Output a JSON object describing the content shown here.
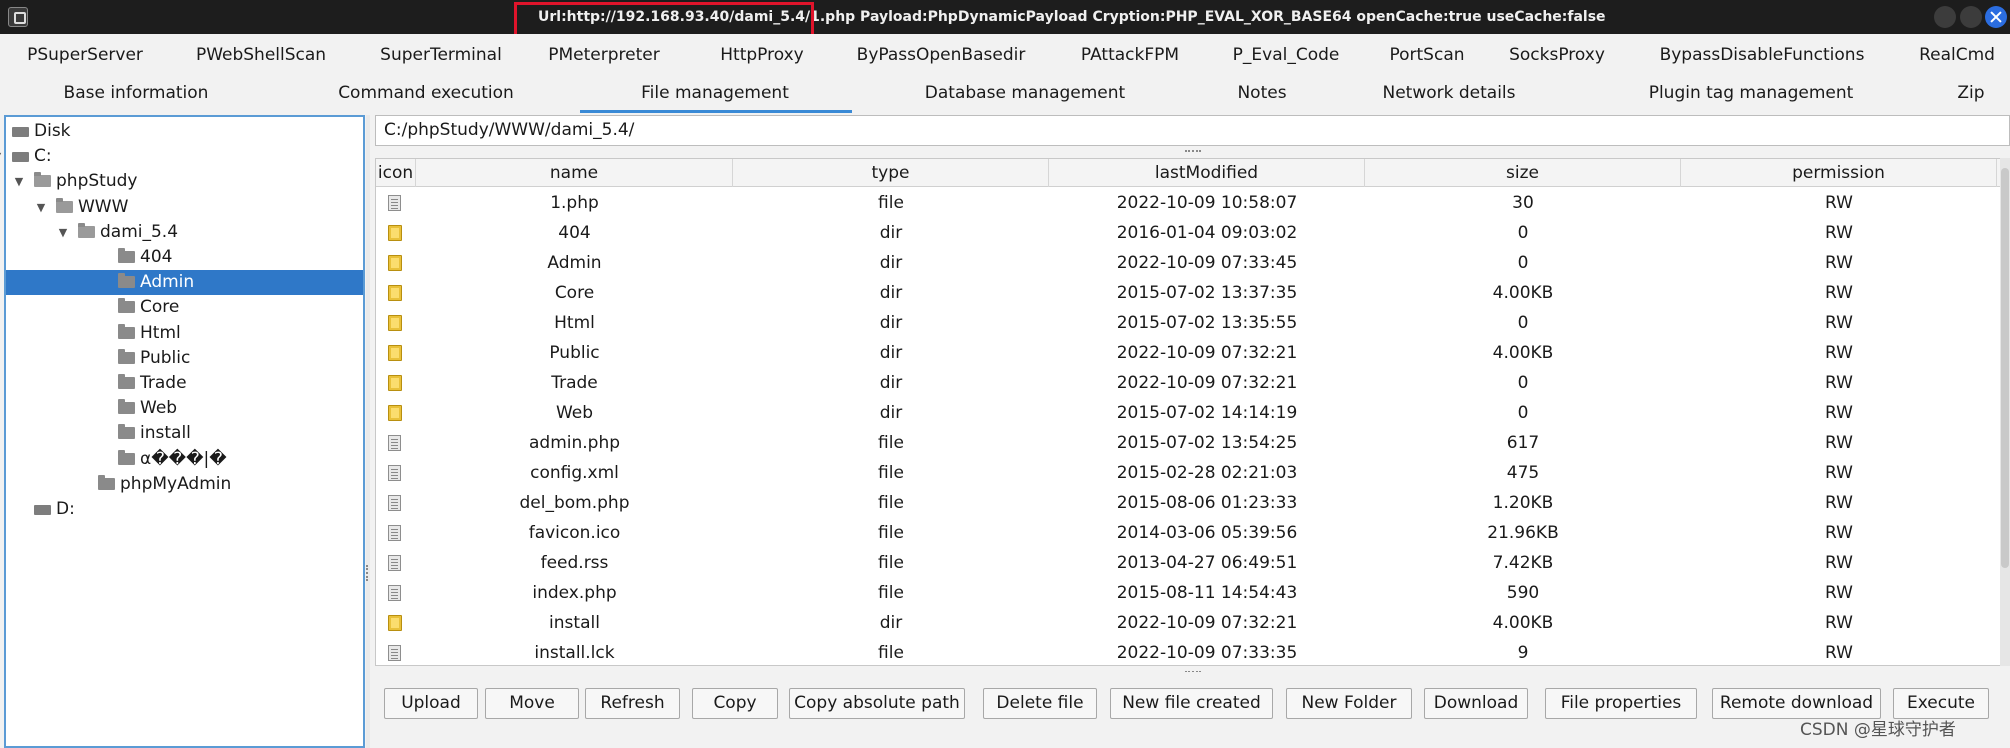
{
  "window": {
    "title": "Url:http://192.168.93.40/dami_5.4/1.php Payload:PhpDynamicPayload Cryption:PHP_EVAL_XOR_BASE64 openCache:true useCache:false",
    "highlight_color": "#e0142b"
  },
  "plugin_tabs": [
    "PSuperServer",
    "PWebShellScan",
    "SuperTerminal",
    "PMeterpreter",
    "HttpProxy",
    "ByPassOpenBasedir",
    "PAttackFPM",
    "P_Eval_Code",
    "PortScan",
    "SocksProxy",
    "BypassDisableFunctions",
    "RealCmd"
  ],
  "main_tabs": [
    "Base information",
    "Command execution",
    "File management",
    "Database management",
    "Notes",
    "Network details",
    "Plugin tag management",
    "Zip"
  ],
  "active_main_tab": "File management",
  "tree": [
    {
      "label": "Disk",
      "icon": "disk-icon",
      "twisty": ""
    },
    {
      "label": "C:",
      "icon": "disk-icon",
      "twisty": "▼"
    },
    {
      "label": "phpStudy",
      "icon": "folder-open-icon",
      "twisty": "▼"
    },
    {
      "label": "WWW",
      "icon": "folder-open-icon",
      "twisty": "▼"
    },
    {
      "label": "dami_5.4",
      "icon": "folder-open-icon",
      "twisty": "▼"
    },
    {
      "label": "404",
      "icon": "folder-icon",
      "twisty": ""
    },
    {
      "label": "Admin",
      "icon": "folder-icon",
      "twisty": "",
      "selected": true
    },
    {
      "label": "Core",
      "icon": "folder-icon",
      "twisty": ""
    },
    {
      "label": "Html",
      "icon": "folder-icon",
      "twisty": ""
    },
    {
      "label": "Public",
      "icon": "folder-icon",
      "twisty": ""
    },
    {
      "label": "Trade",
      "icon": "folder-icon",
      "twisty": ""
    },
    {
      "label": "Web",
      "icon": "folder-icon",
      "twisty": ""
    },
    {
      "label": "install",
      "icon": "folder-icon",
      "twisty": ""
    },
    {
      "label": "α���|�",
      "icon": "folder-icon",
      "twisty": ""
    },
    {
      "label": "phpMyAdmin",
      "icon": "folder-icon",
      "twisty": ""
    },
    {
      "label": "D:",
      "icon": "disk-icon",
      "twisty": ""
    }
  ],
  "path": "C:/phpStudy/WWW/dami_5.4/",
  "table": {
    "columns": [
      "icon",
      "name",
      "type",
      "lastModified",
      "size",
      "permission"
    ],
    "rows": [
      {
        "name": "1.php",
        "type": "file",
        "lastModified": "2022-10-09 10:58:07",
        "size": "30",
        "permission": "RW"
      },
      {
        "name": "404",
        "type": "dir",
        "lastModified": "2016-01-04 09:03:02",
        "size": "0",
        "permission": "RW"
      },
      {
        "name": "Admin",
        "type": "dir",
        "lastModified": "2022-10-09 07:33:45",
        "size": "0",
        "permission": "RW"
      },
      {
        "name": "Core",
        "type": "dir",
        "lastModified": "2015-07-02 13:37:35",
        "size": "4.00KB",
        "permission": "RW"
      },
      {
        "name": "Html",
        "type": "dir",
        "lastModified": "2015-07-02 13:35:55",
        "size": "0",
        "permission": "RW"
      },
      {
        "name": "Public",
        "type": "dir",
        "lastModified": "2022-10-09 07:32:21",
        "size": "4.00KB",
        "permission": "RW"
      },
      {
        "name": "Trade",
        "type": "dir",
        "lastModified": "2022-10-09 07:32:21",
        "size": "0",
        "permission": "RW"
      },
      {
        "name": "Web",
        "type": "dir",
        "lastModified": "2015-07-02 14:14:19",
        "size": "0",
        "permission": "RW"
      },
      {
        "name": "admin.php",
        "type": "file",
        "lastModified": "2015-07-02 13:54:25",
        "size": "617",
        "permission": "RW"
      },
      {
        "name": "config.xml",
        "type": "file",
        "lastModified": "2015-02-28 02:21:03",
        "size": "475",
        "permission": "RW"
      },
      {
        "name": "del_bom.php",
        "type": "file",
        "lastModified": "2015-08-06 01:23:33",
        "size": "1.20KB",
        "permission": "RW"
      },
      {
        "name": "favicon.ico",
        "type": "file",
        "lastModified": "2014-03-06 05:39:56",
        "size": "21.96KB",
        "permission": "RW"
      },
      {
        "name": "feed.rss",
        "type": "file",
        "lastModified": "2013-04-27 06:49:51",
        "size": "7.42KB",
        "permission": "RW"
      },
      {
        "name": "index.php",
        "type": "file",
        "lastModified": "2015-08-11 14:54:43",
        "size": "590",
        "permission": "RW"
      },
      {
        "name": "install",
        "type": "dir",
        "lastModified": "2022-10-09 07:32:21",
        "size": "4.00KB",
        "permission": "RW"
      },
      {
        "name": "install.lck",
        "type": "file",
        "lastModified": "2022-10-09 07:33:35",
        "size": "9",
        "permission": "RW"
      }
    ]
  },
  "toolbar": [
    "Upload",
    "Move",
    "Refresh",
    "Copy",
    "Copy absolute path",
    "Delete file",
    "New file created",
    "New Folder",
    "Download",
    "File properties",
    "Remote download",
    "Execute"
  ],
  "watermark": "CSDN @星球守护者"
}
